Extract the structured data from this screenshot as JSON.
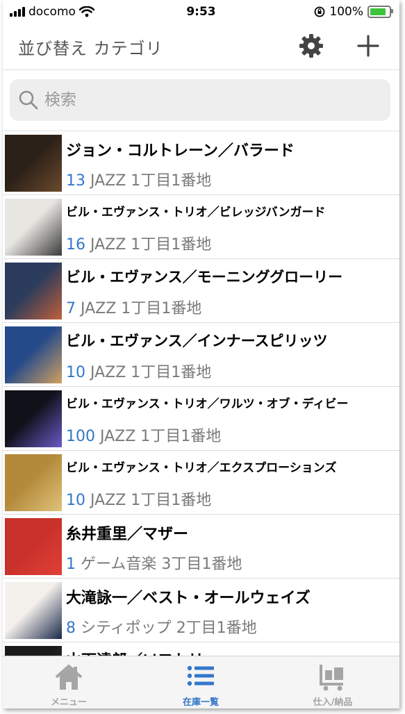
{
  "status_bar": {
    "carrier": "docomo",
    "time": "9:53",
    "battery_percent": "100%",
    "battery_level": 1.0
  },
  "nav": {
    "title": "並び替え カテゴリ",
    "settings_icon": "gear-icon",
    "add_icon": "plus-icon"
  },
  "search": {
    "placeholder": "検索",
    "value": ""
  },
  "items": [
    {
      "title": "ジョン・コルトレーン／バラード",
      "qty": "13",
      "category": "JAZZ",
      "location": "1丁目1番地",
      "colors": [
        "#2b2018",
        "#6b4a2c"
      ]
    },
    {
      "title": "ビル・エヴァンス・トリオ／ビレッジバンガード",
      "qty": "16",
      "category": "JAZZ",
      "location": "1丁目1番地",
      "colors": [
        "#e8e6e1",
        "#3a3a3a"
      ]
    },
    {
      "title": "ビル・エヴァンス／モーニンググローリー",
      "qty": "7",
      "category": "JAZZ",
      "location": "1丁目1番地",
      "colors": [
        "#2a3b5c",
        "#c0603a"
      ]
    },
    {
      "title": "ビル・エヴァンス／インナースピリッツ",
      "qty": "10",
      "category": "JAZZ",
      "location": "1丁目1番地",
      "colors": [
        "#254a8a",
        "#d0a060"
      ]
    },
    {
      "title": "ビル・エヴァンス・トリオ／ワルツ・オブ・ディビー",
      "qty": "100",
      "category": "JAZZ",
      "location": "1丁目1番地",
      "colors": [
        "#11111a",
        "#6a5ac8"
      ]
    },
    {
      "title": "ビル・エヴァンス・トリオ／エクスプローションズ",
      "qty": "10",
      "category": "JAZZ",
      "location": "1丁目1番地",
      "colors": [
        "#b38a3a",
        "#e0c27a"
      ]
    },
    {
      "title": "糸井重里／マザー",
      "qty": "1",
      "category": "ゲーム音楽",
      "location": "3丁目1番地",
      "colors": [
        "#c8302a",
        "#e04036"
      ]
    },
    {
      "title": "大滝詠一／ベスト・オールウェイズ",
      "qty": "8",
      "category": "シティポップ",
      "location": "2丁目1番地",
      "colors": [
        "#f4f0ec",
        "#1a2a4a"
      ]
    },
    {
      "title": "山下達郎／ソフトリー",
      "qty": "",
      "category": "",
      "location": "",
      "colors": [
        "#1a1a1a",
        "#444444"
      ]
    }
  ],
  "tabbar": {
    "tabs": [
      {
        "label": "メニュー",
        "icon": "home-icon",
        "color": "#a5a5a5"
      },
      {
        "label": "在庫一覧",
        "icon": "list-icon",
        "color": "#3478c8"
      },
      {
        "label": "仕入/納品",
        "icon": "cart-icon",
        "color": "#a5a5a5"
      }
    ]
  }
}
